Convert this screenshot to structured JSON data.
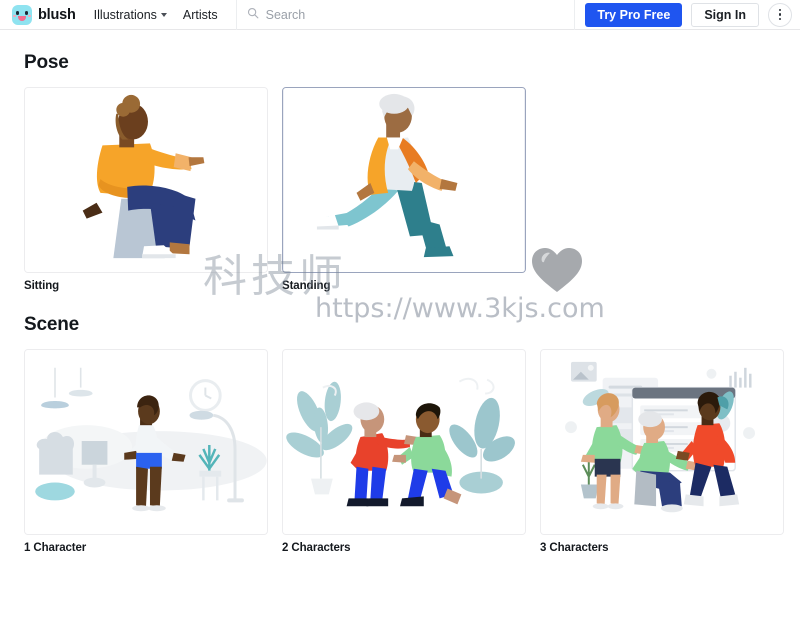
{
  "header": {
    "brand": {
      "name": "blush",
      "icon": "blush-mascot-logo"
    },
    "nav": [
      {
        "label": "Illustrations",
        "has_dropdown": true
      },
      {
        "label": "Artists",
        "has_dropdown": false
      }
    ],
    "search": {
      "placeholder": "Search",
      "value": "",
      "icon": "search-icon"
    },
    "actions": {
      "pro_label": "Try Pro Free",
      "signin_label": "Sign In",
      "more_icon": "kebab-menu-icon"
    },
    "accent_color": "#1f55f0"
  },
  "sections": [
    {
      "title": "Pose",
      "cards": [
        {
          "label": "Sitting",
          "selected": false,
          "art": "person-sitting-orange-top-navy-pants"
        },
        {
          "label": "Standing",
          "selected": true,
          "art": "person-walking-orange-jacket-teal-pants"
        }
      ]
    },
    {
      "title": "Scene",
      "cards": [
        {
          "label": "1 Character",
          "selected": false,
          "art": "interior-room-one-character"
        },
        {
          "label": "2 Characters",
          "selected": false,
          "art": "plants-two-characters"
        },
        {
          "label": "3 Characters",
          "selected": false,
          "art": "dashboard-three-characters"
        }
      ]
    }
  ],
  "watermark": {
    "chinese": "科技师",
    "url": "https://www.3kjs.com",
    "heart_icon": "heart-icon"
  }
}
